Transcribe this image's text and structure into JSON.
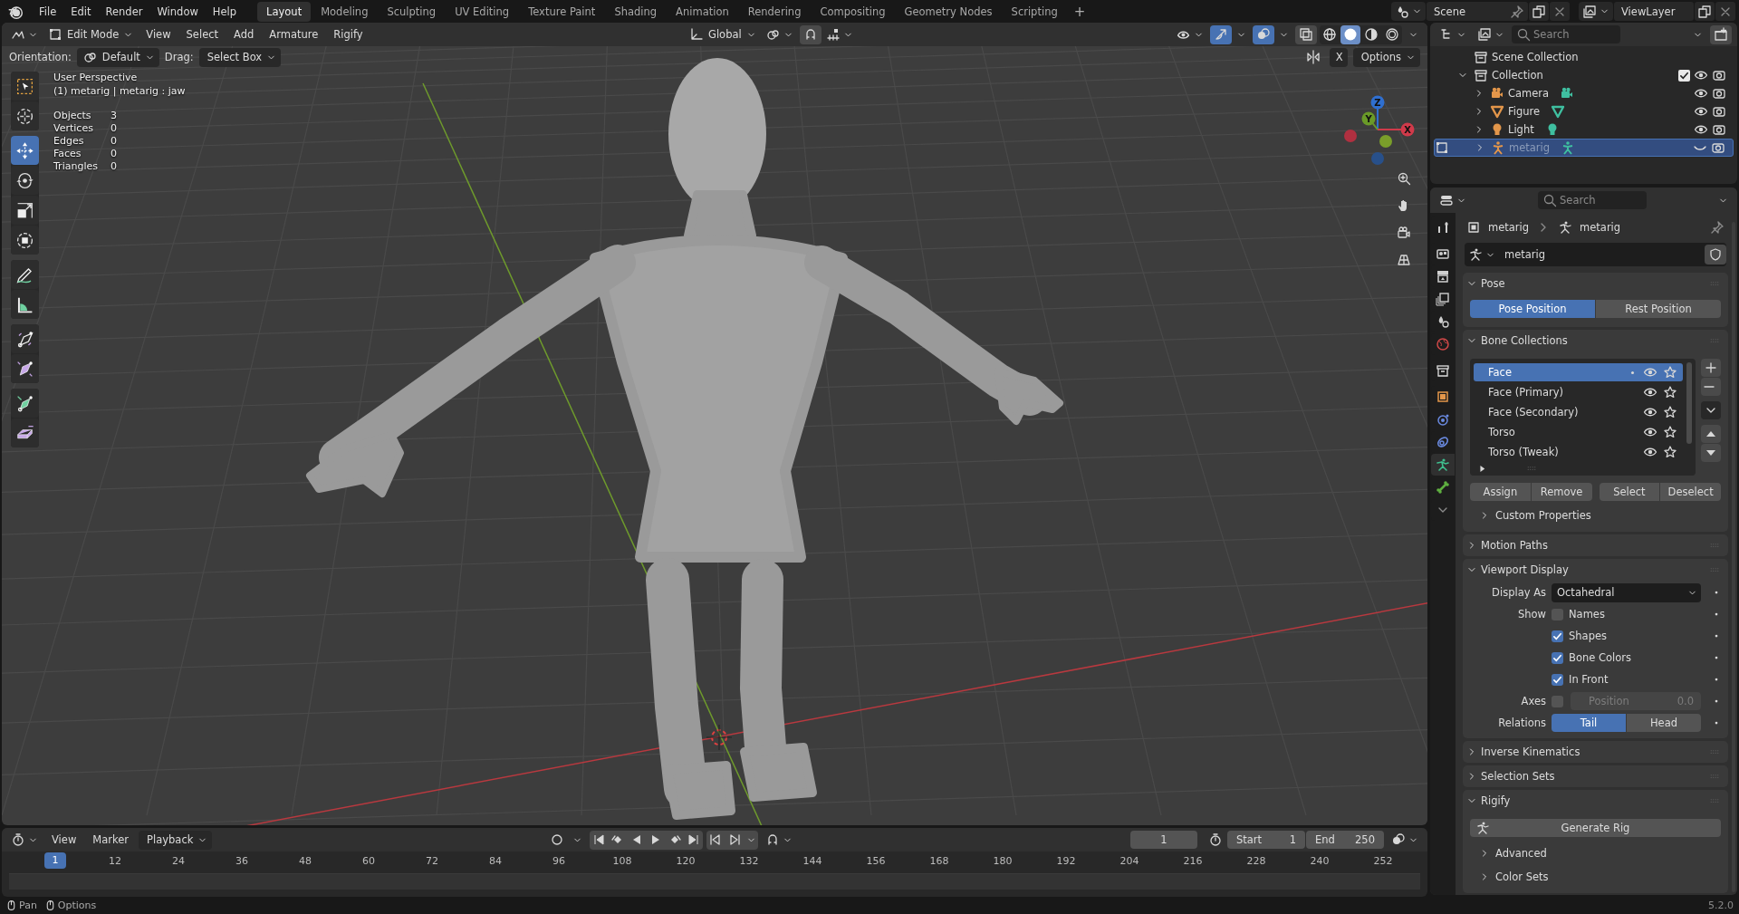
{
  "topbar": {
    "menus": [
      "File",
      "Edit",
      "Render",
      "Window",
      "Help"
    ],
    "workspaces": [
      {
        "label": "Layout",
        "selected": true
      },
      {
        "label": "Modeling",
        "selected": false
      },
      {
        "label": "Sculpting",
        "selected": false
      },
      {
        "label": "UV Editing",
        "selected": false
      },
      {
        "label": "Texture Paint",
        "selected": false
      },
      {
        "label": "Shading",
        "selected": false
      },
      {
        "label": "Animation",
        "selected": false
      },
      {
        "label": "Rendering",
        "selected": false
      },
      {
        "label": "Compositing",
        "selected": false
      },
      {
        "label": "Geometry Nodes",
        "selected": false
      },
      {
        "label": "Scripting",
        "selected": false
      }
    ],
    "add_workspace": "+",
    "scene": "Scene",
    "view_layer": "ViewLayer"
  },
  "viewport": {
    "header": {
      "mode": "Edit Mode",
      "menus": [
        "View",
        "Select",
        "Add",
        "Armature",
        "Rigify"
      ],
      "orientation": "Global",
      "gizmos_on": true,
      "overlays_on": true,
      "shading": [
        {
          "kind": "wireframe",
          "selected": false
        },
        {
          "kind": "solid",
          "selected": true
        },
        {
          "kind": "material",
          "selected": false
        },
        {
          "kind": "rendered",
          "selected": false
        }
      ]
    },
    "tool_settings": {
      "orientation_label": "Orientation:",
      "orientation": "Default",
      "drag_label": "Drag:",
      "drag": "Select Box",
      "mirror": "X",
      "options": "Options"
    },
    "info": {
      "view": "User Perspective",
      "context": "(1) metarig | metarig : jaw"
    },
    "stats": [
      {
        "label": "Objects",
        "value": "3"
      },
      {
        "label": "Vertices",
        "value": "0"
      },
      {
        "label": "Edges",
        "value": "0"
      },
      {
        "label": "Faces",
        "value": "0"
      },
      {
        "label": "Triangles",
        "value": "0"
      }
    ],
    "tool_groups": [
      {
        "tools": [
          {
            "kind": "select",
            "selected": false
          },
          {
            "kind": "cursor",
            "selected": false
          }
        ]
      },
      {
        "tools": [
          {
            "kind": "move",
            "selected": true
          },
          {
            "kind": "rotate",
            "selected": false
          },
          {
            "kind": "scale",
            "selected": false
          },
          {
            "kind": "transform",
            "selected": false
          }
        ]
      },
      {
        "tools": [
          {
            "kind": "annotate",
            "selected": false
          },
          {
            "kind": "measure",
            "selected": false
          }
        ]
      },
      {
        "tools": [
          {
            "kind": "roll",
            "selected": false
          },
          {
            "kind": "bone_size",
            "selected": false
          }
        ]
      },
      {
        "tools": [
          {
            "kind": "extrude",
            "selected": false
          },
          {
            "kind": "shear",
            "selected": false
          }
        ]
      }
    ],
    "gizmo": {
      "x": "X",
      "y": "Y",
      "z": "Z"
    }
  },
  "timeline": {
    "menus": [
      "View",
      "Marker"
    ],
    "playback": "Playback",
    "current_frame": "1",
    "start_label": "Start",
    "start": "1",
    "end_label": "End",
    "end": "250",
    "playhead": "1",
    "ticks": [
      "12",
      "24",
      "36",
      "48",
      "60",
      "72",
      "84",
      "96",
      "108",
      "120",
      "132",
      "144",
      "156",
      "168",
      "180",
      "192",
      "204",
      "216",
      "228",
      "240",
      "252"
    ]
  },
  "outliner": {
    "search": {
      "placeholder": "Search"
    },
    "tree": [
      {
        "label": "Scene Collection",
        "kind": "scene_collection",
        "children": [
          {
            "label": "Collection",
            "kind": "collection",
            "expanded": true,
            "checked": true,
            "children": [
              {
                "label": "Camera",
                "kind": "camera",
                "selected": false,
                "visible": true,
                "expanded": false,
                "edit_mode": false
              },
              {
                "label": "Figure",
                "kind": "mesh",
                "selected": false,
                "visible": true,
                "expanded": false,
                "edit_mode": false
              },
              {
                "label": "Light",
                "kind": "light",
                "selected": false,
                "visible": true,
                "expanded": false,
                "edit_mode": false
              },
              {
                "label": "metarig",
                "kind": "armature",
                "selected": true,
                "visible": false,
                "expanded": false,
                "edit_mode": true
              }
            ]
          }
        ]
      }
    ]
  },
  "properties": {
    "search": {
      "placeholder": "Search"
    },
    "tabs": [
      {
        "kind": "tool",
        "selected": false
      },
      {
        "kind": "render",
        "selected": false
      },
      {
        "kind": "output",
        "selected": false
      },
      {
        "kind": "view_layer",
        "selected": false
      },
      {
        "kind": "scene",
        "selected": false
      },
      {
        "kind": "world",
        "selected": false
      },
      {
        "kind": "collection",
        "selected": false
      },
      {
        "kind": "object",
        "selected": false
      },
      {
        "kind": "physics",
        "selected": false
      },
      {
        "kind": "constraints",
        "selected": false
      },
      {
        "kind": "data",
        "selected": true
      },
      {
        "kind": "bone",
        "selected": false
      }
    ],
    "breadcrumb": [
      "metarig",
      "metarig"
    ],
    "datablock": "metarig",
    "panels": [
      {
        "title": "Pose",
        "expanded": true,
        "rows": [
          {
            "kind": "segmented",
            "options": [
              {
                "label": "Pose Position",
                "selected": true
              },
              {
                "label": "Rest Position",
                "selected": false
              }
            ]
          }
        ]
      },
      {
        "title": "Bone Collections",
        "expanded": true,
        "rows": [
          {
            "kind": "bone_list",
            "items": [
              {
                "label": "Face",
                "selected": true,
                "visible": true
              },
              {
                "label": "Face (Primary)",
                "selected": false,
                "visible": true
              },
              {
                "label": "Face (Secondary)",
                "selected": false,
                "visible": true
              },
              {
                "label": "Torso",
                "selected": false,
                "visible": true
              },
              {
                "label": "Torso (Tweak)",
                "selected": false,
                "visible": true
              }
            ]
          },
          {
            "kind": "button_groups",
            "groups": [
              [
                "Assign",
                "Remove"
              ],
              [
                "Select",
                "Deselect"
              ]
            ]
          },
          {
            "kind": "subpanel",
            "label": "Custom Properties",
            "expanded": false
          }
        ]
      },
      {
        "title": "Motion Paths",
        "expanded": false
      },
      {
        "title": "Viewport Display",
        "expanded": true,
        "rows": [
          {
            "kind": "dropdown",
            "label": "Display As",
            "value": "Octahedral"
          },
          {
            "kind": "checkbox",
            "label": "Show",
            "text": "Names",
            "checked": false
          },
          {
            "kind": "checkbox",
            "text": "Shapes",
            "checked": true
          },
          {
            "kind": "checkbox",
            "text": "Bone Colors",
            "checked": true
          },
          {
            "kind": "checkbox",
            "text": "In Front",
            "checked": true
          },
          {
            "kind": "axes",
            "label": "Axes",
            "checked": false,
            "field": "Position",
            "value": "0.0"
          },
          {
            "kind": "segmented",
            "label": "Relations",
            "options": [
              {
                "label": "Tail",
                "selected": true
              },
              {
                "label": "Head",
                "selected": false
              }
            ]
          }
        ]
      },
      {
        "title": "Inverse Kinematics",
        "expanded": false
      },
      {
        "title": "Selection Sets",
        "expanded": false
      },
      {
        "title": "Rigify",
        "expanded": true,
        "rows": [
          {
            "kind": "wide_button",
            "label": "Generate Rig"
          },
          {
            "kind": "subpanel",
            "label": "Advanced",
            "expanded": false
          },
          {
            "kind": "subpanel",
            "label": "Color Sets",
            "expanded": false
          }
        ]
      }
    ]
  },
  "status_bar": {
    "hints": [
      "Pan",
      "Options"
    ],
    "version": "5.2.0"
  }
}
